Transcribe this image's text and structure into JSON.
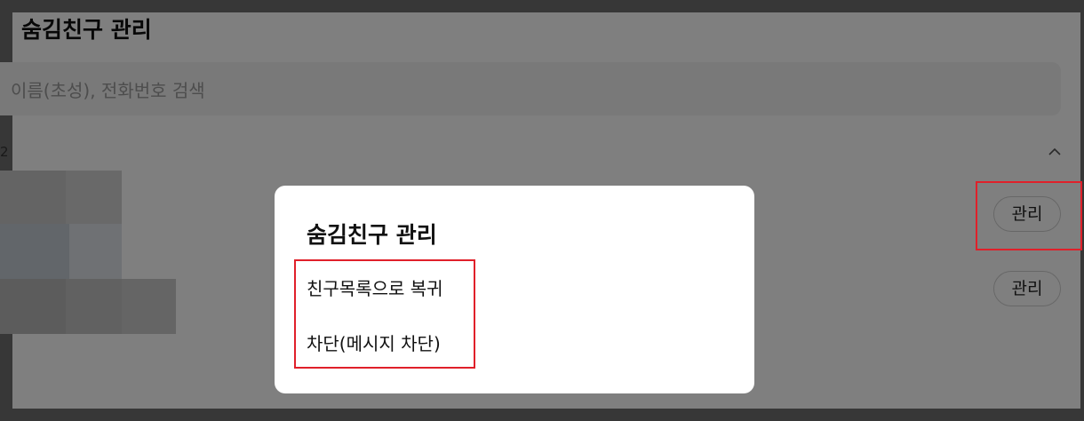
{
  "background_panel": {
    "title": "숨김친구 관리",
    "search": {
      "placeholder": "이름(초성), 전화번호 검색"
    },
    "count_label": "2",
    "rows": [
      {
        "manage_label": "관리"
      },
      {
        "manage_label": "관리"
      }
    ]
  },
  "modal": {
    "title": "숨김친구 관리",
    "options": [
      {
        "label": "친구목록으로 복귀"
      },
      {
        "label": "차단(메시지 차단)"
      }
    ]
  },
  "colors": {
    "highlight": "#e0202a",
    "overlay": "rgba(0,0,0,0.5)"
  }
}
